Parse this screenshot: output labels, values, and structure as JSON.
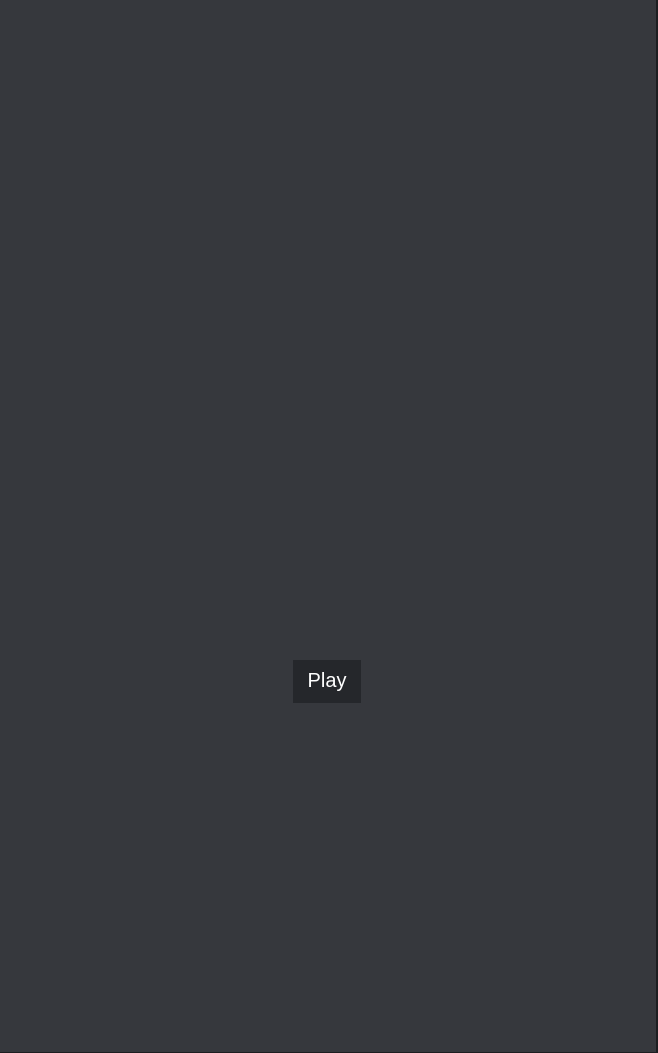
{
  "colors": {
    "background": "#36383d",
    "button_background": "#25272b",
    "button_text": "#ffffff",
    "edge": "#1d1e21"
  },
  "main": {
    "play_button_label": "Play"
  }
}
